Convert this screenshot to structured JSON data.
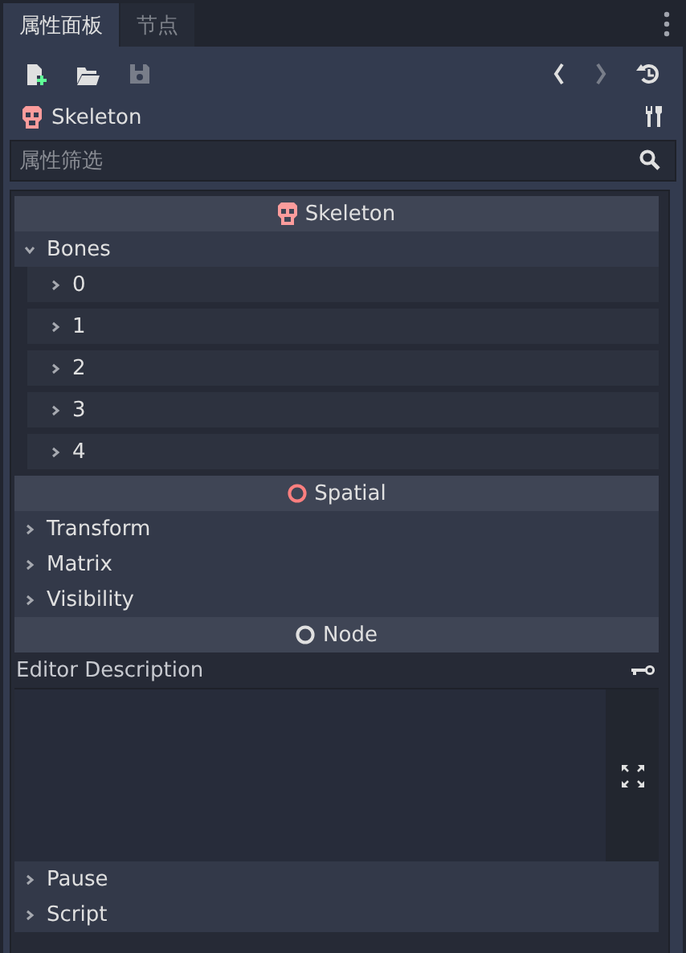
{
  "tabs": [
    {
      "label": "属性面板",
      "selected": true
    },
    {
      "label": "节点",
      "selected": false
    }
  ],
  "toolbar": [
    {
      "kind": "new",
      "disabled": false
    },
    {
      "kind": "open",
      "disabled": false
    },
    {
      "kind": "save",
      "disabled": true
    },
    {
      "kind": "back",
      "disabled": false
    },
    {
      "kind": "forward",
      "disabled": true
    },
    {
      "kind": "history",
      "disabled": false
    }
  ],
  "object": {
    "name": "Skeleton"
  },
  "filter": {
    "placeholder": "属性筛选"
  },
  "sections": [
    {
      "kind": "category",
      "title": "Skeleton"
    },
    {
      "kind": "group",
      "label": "Bones",
      "expanded": true,
      "children": [
        {
          "label": "0",
          "expanded": false
        },
        {
          "label": "1",
          "expanded": false
        },
        {
          "label": "2",
          "expanded": false
        },
        {
          "label": "3",
          "expanded": false
        },
        {
          "label": "4",
          "expanded": false
        }
      ]
    },
    {
      "kind": "category",
      "title": "Spatial",
      "color": "#fc7f7f"
    },
    {
      "kind": "group",
      "label": "Transform",
      "expanded": false
    },
    {
      "kind": "group",
      "label": "Matrix",
      "expanded": false
    },
    {
      "kind": "group",
      "label": "Visibility",
      "expanded": false
    },
    {
      "kind": "category",
      "title": "Node",
      "color": "#e0e0e0"
    },
    {
      "kind": "text",
      "label": "Editor Description"
    },
    {
      "kind": "group",
      "label": "Pause",
      "expanded": false
    },
    {
      "kind": "group",
      "label": "Script",
      "expanded": false
    }
  ]
}
